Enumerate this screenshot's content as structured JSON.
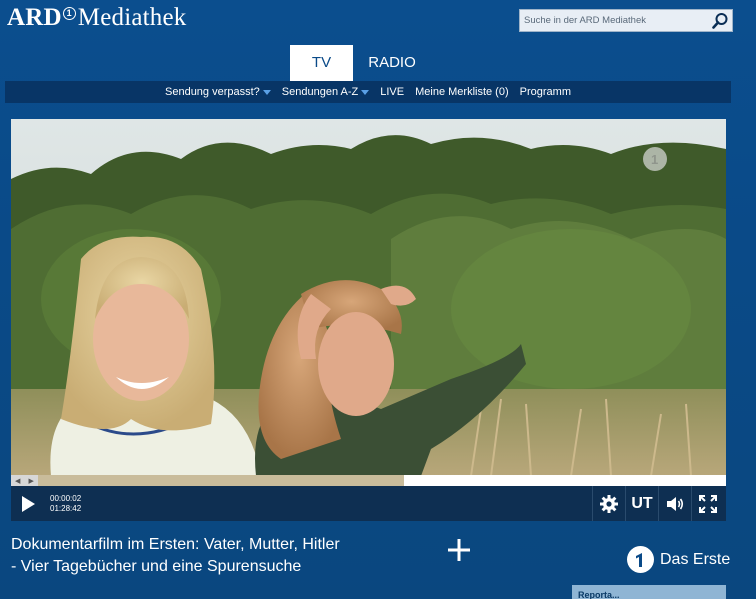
{
  "header": {
    "brand": "ARD",
    "brand_reg": "1",
    "brand_suffix": "Mediathek",
    "search_placeholder": "Suche in der ARD Mediathek"
  },
  "tabs": [
    {
      "label": "TV",
      "active": true
    },
    {
      "label": "RADIO",
      "active": false
    }
  ],
  "subnav": [
    {
      "label": "Sendung verpasst?",
      "dropdown": true
    },
    {
      "label": "Sendungen A-Z",
      "dropdown": true
    },
    {
      "label": "LIVE",
      "dropdown": false
    },
    {
      "label": "Meine Merkliste (0)",
      "dropdown": false
    },
    {
      "label": "Programm",
      "dropdown": false
    }
  ],
  "player": {
    "elapsed": "00:00:02",
    "duration": "01:28:42",
    "buffered_fraction": 0.55,
    "subtitles_label": "UT",
    "seek_left": "◀",
    "seek_right": "▶"
  },
  "video": {
    "title": "Dokumentarfilm im Ersten: Vater, Mutter, Hitler - Vier Tagebücher und eine Spurensuche",
    "channel": "Das Erste",
    "teaser_label": "Reporta..."
  },
  "colors": {
    "background": "#0a4a88",
    "subnav": "#083566",
    "accent": "#5aa0e6",
    "controls": "#0e2f52",
    "progress_buffer": "#c9bc9b"
  }
}
